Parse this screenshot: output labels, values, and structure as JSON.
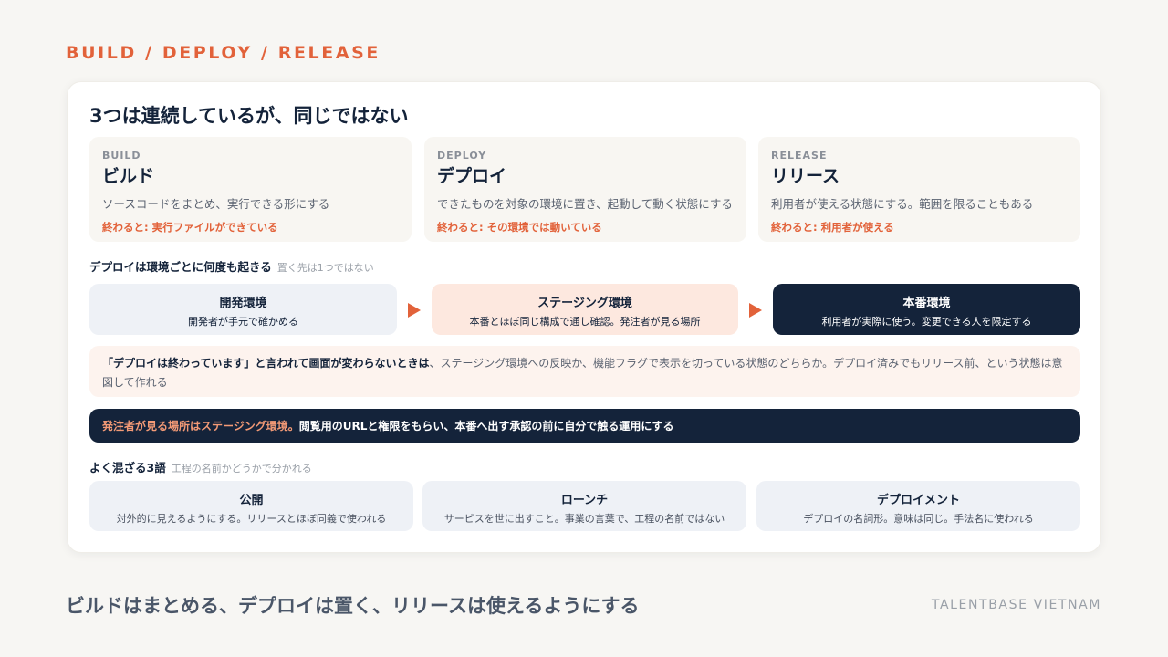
{
  "eyebrow": "BUILD / DEPLOY / RELEASE",
  "card": {
    "title": "3つは連続しているが、同じではない",
    "stages": [
      {
        "label": "BUILD",
        "name": "ビルド",
        "desc": "ソースコードをまとめ、実行できる形にする",
        "done": "終わると: 実行ファイルができている"
      },
      {
        "label": "DEPLOY",
        "name": "デプロイ",
        "desc": "できたものを対象の環境に置き、起動して動く状態にする",
        "done": "終わると: その環境では動いている"
      },
      {
        "label": "RELEASE",
        "name": "リリース",
        "desc": "利用者が使える状態にする。範囲を限ることもある",
        "done": "終わると: 利用者が使える"
      }
    ],
    "deploy_section": {
      "title": "デプロイは環境ごとに何度も起きる",
      "sub": "置く先は1つではない"
    },
    "environments": [
      {
        "title": "開発環境",
        "desc": "開発者が手元で確かめる"
      },
      {
        "title": "ステージング環境",
        "desc": "本番とほぼ同じ構成で通し確認。発注者が見る場所"
      },
      {
        "title": "本番環境",
        "desc": "利用者が実際に使う。変更できる人を限定する"
      }
    ],
    "note": {
      "strong": "「デプロイは終わっています」と言われて画面が変わらないときは",
      "rest": "、ステージング環境への反映か、機能フラグで表示を切っている状態のどちらか。デプロイ済みでもリリース前、という状態は意図して作れる"
    },
    "banner": {
      "highlight": "発注者が見る場所はステージング環境。",
      "rest": "閲覧用のURLと権限をもらい、本番へ出す承認の前に自分で触る運用にする"
    },
    "terms_section": {
      "title": "よく混ざる3語",
      "sub": "工程の名前かどうかで分かれる"
    },
    "terms": [
      {
        "title": "公開",
        "desc": "対外的に見えるようにする。リリースとほぼ同義で使われる"
      },
      {
        "title": "ローンチ",
        "desc": "サービスを世に出すこと。事業の言葉で、工程の名前ではない"
      },
      {
        "title": "デプロイメント",
        "desc": "デプロイの名詞形。意味は同じ。手法名に使われる"
      }
    ]
  },
  "footer": "ビルドはまとめる、デプロイは置く、リリースは使えるようにする",
  "brand": "TALENTBASE VIETNAM",
  "colors": {
    "accent": "#e2623a",
    "navy": "#14233a",
    "peach": "#fde8df",
    "pale_blue": "#eef1f6"
  }
}
